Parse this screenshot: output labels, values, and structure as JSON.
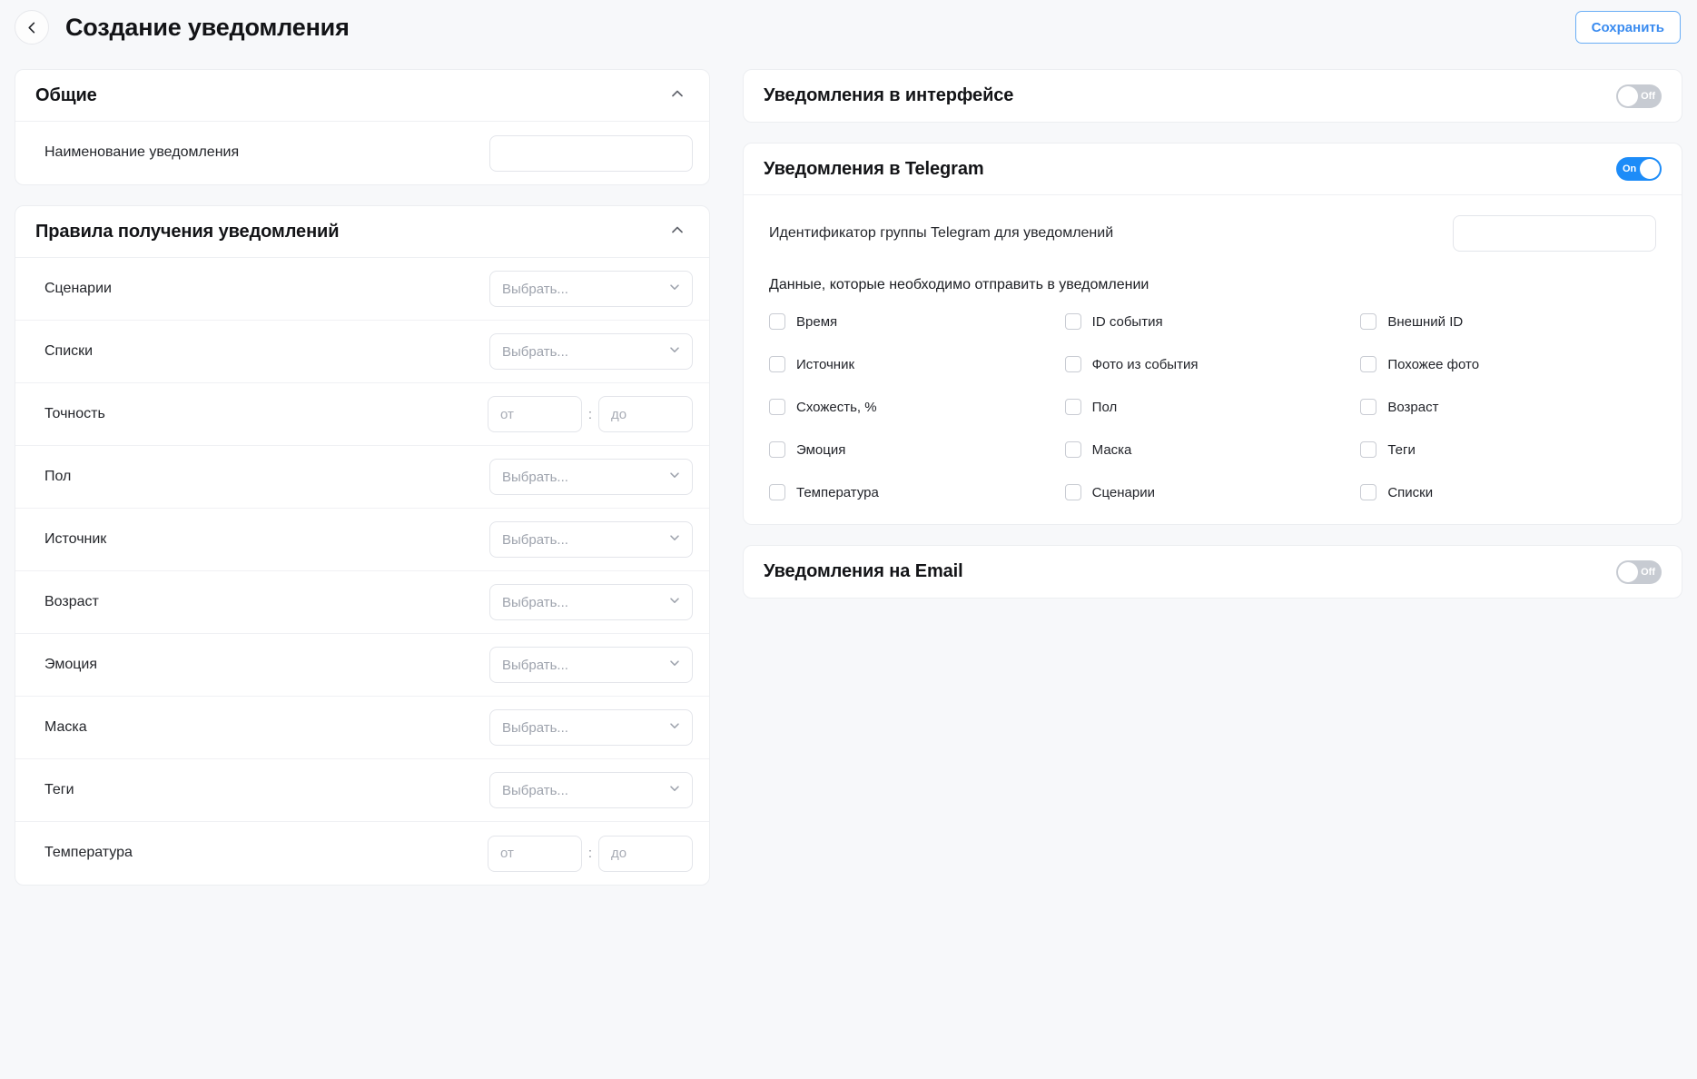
{
  "header": {
    "back_icon": "chevron-left-icon",
    "title": "Создание уведомления",
    "save_label": "Сохранить",
    "accent_color": "#3b8cf0"
  },
  "left": {
    "general": {
      "title": "Общие",
      "collapse_icon": "chevron-up-icon",
      "name_label": "Наименование уведомления",
      "name_value": "",
      "name_placeholder": ""
    },
    "rules": {
      "title": "Правила получения уведомлений",
      "collapse_icon": "chevron-up-icon",
      "select_placeholder": "Выбрать...",
      "range_from_placeholder": "от",
      "range_to_placeholder": "до",
      "range_separator": ":",
      "rows": [
        {
          "label": "Сценарии",
          "type": "select"
        },
        {
          "label": "Списки",
          "type": "select"
        },
        {
          "label": "Точность",
          "type": "range"
        },
        {
          "label": "Пол",
          "type": "select"
        },
        {
          "label": "Источник",
          "type": "select"
        },
        {
          "label": "Возраст",
          "type": "select"
        },
        {
          "label": "Эмоция",
          "type": "select"
        },
        {
          "label": "Маска",
          "type": "select"
        },
        {
          "label": "Теги",
          "type": "select"
        },
        {
          "label": "Температура",
          "type": "range"
        }
      ]
    }
  },
  "right": {
    "interface": {
      "title": "Уведомления в интерфейсе",
      "toggle_state": "off",
      "toggle_label": "Off"
    },
    "telegram": {
      "title": "Уведомления в Telegram",
      "toggle_state": "on",
      "toggle_label": "On",
      "toggle_on_color": "#1d8cf8",
      "group_id_label": "Идентификатор группы Telegram для уведомлений",
      "group_id_value": "",
      "data_section_label": "Данные, которые необходимо отправить в уведомлении",
      "checkboxes": [
        {
          "label": "Время",
          "checked": false
        },
        {
          "label": "ID события",
          "checked": false
        },
        {
          "label": "Внешний ID",
          "checked": false
        },
        {
          "label": "Источник",
          "checked": false
        },
        {
          "label": "Фото из события",
          "checked": false
        },
        {
          "label": "Похожее фото",
          "checked": false
        },
        {
          "label": "Схожесть, %",
          "checked": false
        },
        {
          "label": "Пол",
          "checked": false
        },
        {
          "label": "Возраст",
          "checked": false
        },
        {
          "label": "Эмоция",
          "checked": false
        },
        {
          "label": "Маска",
          "checked": false
        },
        {
          "label": "Теги",
          "checked": false
        },
        {
          "label": "Температура",
          "checked": false
        },
        {
          "label": "Сценарии",
          "checked": false
        },
        {
          "label": "Списки",
          "checked": false
        }
      ]
    },
    "email": {
      "title": "Уведомления на Email",
      "toggle_state": "off",
      "toggle_label": "Off"
    }
  }
}
